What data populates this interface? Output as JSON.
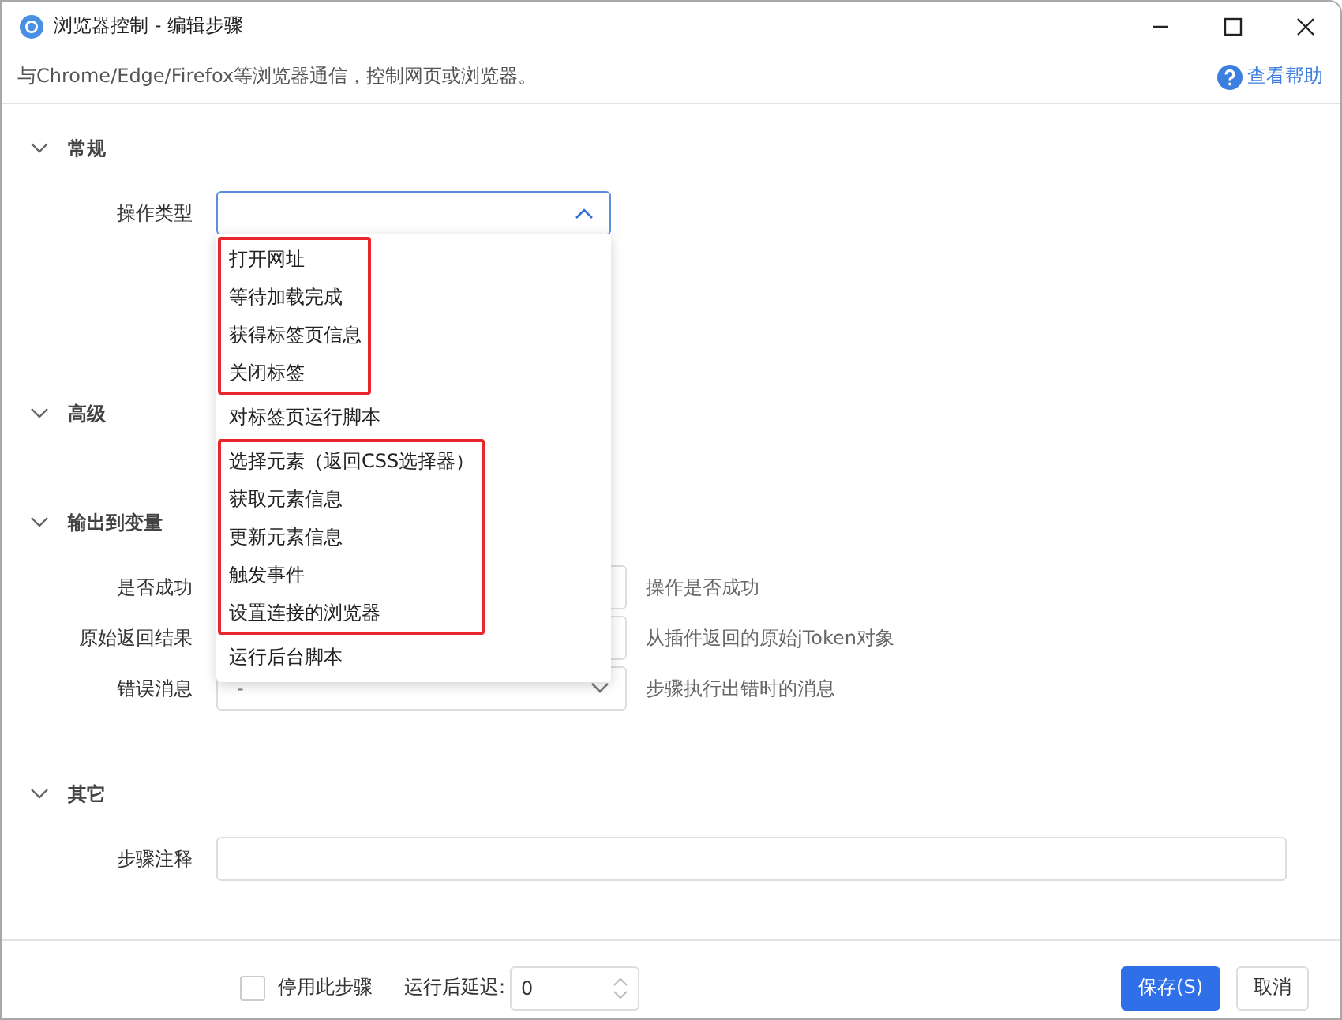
{
  "window": {
    "title": "浏览器控制 - 编辑步骤"
  },
  "description": "与Chrome/Edge/Firefox等浏览器通信，控制网页或浏览器。",
  "help_link": "查看帮助",
  "sections": [
    {
      "title": "常规",
      "expanded": true,
      "fields": [
        {
          "label": "操作类型",
          "kind": "select",
          "open": true,
          "dropdown": [
            {
              "highlighted": true,
              "options": [
                "打开网址",
                "等待加载完成",
                "获得标签页信息",
                "关闭标签"
              ]
            },
            {
              "highlighted": false,
              "options": [
                "对标签页运行脚本"
              ]
            },
            {
              "highlighted": true,
              "options": [
                "选择元素（返回CSS选择器）",
                "获取元素信息",
                "更新元素信息",
                "触发事件",
                "设置连接的浏览器"
              ]
            },
            {
              "highlighted": false,
              "options": [
                "运行后台脚本"
              ]
            }
          ]
        }
      ]
    },
    {
      "title": "高级",
      "expanded": true
    },
    {
      "title": "输出到变量",
      "expanded": true,
      "fields": [
        {
          "label": "是否成功",
          "kind": "text",
          "hint": "操作是否成功"
        },
        {
          "label": "原始返回结果",
          "kind": "text",
          "hint": "从插件返回的原始jToken对象"
        },
        {
          "label": "错误消息",
          "kind": "select",
          "open": false,
          "value": "-",
          "hint": "步骤执行出错时的消息"
        }
      ]
    },
    {
      "title": "其它",
      "expanded": true,
      "fields": [
        {
          "label": "步骤注释",
          "kind": "note"
        }
      ]
    }
  ],
  "footer": {
    "disable_checkbox": {
      "label": "停用此步骤",
      "checked": false
    },
    "delay": {
      "label": "运行后延迟:",
      "value": "0"
    },
    "buttons": [
      {
        "label": "保存(S)",
        "primary": true
      },
      {
        "label": "取消",
        "primary": false
      }
    ]
  }
}
